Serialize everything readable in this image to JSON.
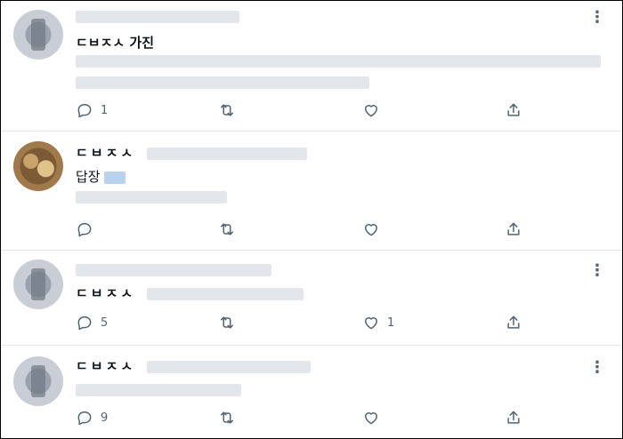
{
  "tweets": [
    {
      "name": "ㄷㅂㅈㅅ 가진",
      "reply_prefix": "",
      "reply_count": "1",
      "retweet_count": "",
      "like_count": ""
    },
    {
      "name": "ㄷㅂㅈㅅ",
      "reply_prefix": "답장",
      "reply_count": "",
      "retweet_count": "",
      "like_count": ""
    },
    {
      "name": "ㄷㅂㅈㅅ",
      "reply_prefix": "",
      "reply_count": "5",
      "retweet_count": "",
      "like_count": "1"
    },
    {
      "name": "ㄷㅂㅈㅅ",
      "reply_prefix": "",
      "reply_count": "9",
      "retweet_count": "",
      "like_count": ""
    }
  ],
  "icons": {
    "more": "more-icon",
    "reply": "reply-icon",
    "retweet": "retweet-icon",
    "like": "like-icon",
    "share": "share-icon"
  },
  "colors": {
    "icon": "#536471",
    "divider": "#e1e6ea",
    "link_blur": "#b9d3ee"
  }
}
